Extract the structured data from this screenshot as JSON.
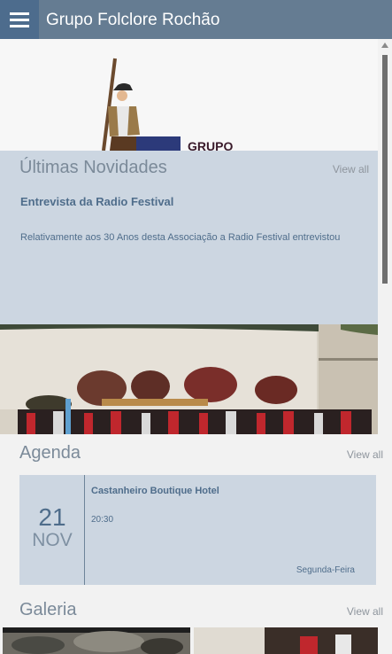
{
  "app": {
    "title": "Grupo Folclore Rochão"
  },
  "logo": {
    "text": "GRUPO"
  },
  "news": {
    "heading": "Últimas Novidades",
    "view_all": "View all",
    "item_title": "Entrevista da Radio Festival",
    "item_excerpt": "Relativamente aos 30 Anos desta Associação a Radio Festival entrevistou"
  },
  "agenda": {
    "heading": "Agenda",
    "view_all": "View all",
    "event": {
      "day": "21",
      "month": "NOV",
      "title": "Castanheiro Boutique Hotel",
      "time": "20:30",
      "weekday": "Segunda-Feira"
    }
  },
  "gallery": {
    "heading": "Galeria",
    "view_all": "View all"
  },
  "icons": {
    "menu": "hamburger-menu-icon",
    "scroll_up": "scroll-up-arrow-icon"
  },
  "colors": {
    "appbar": "#657c92",
    "menu_button": "#4d6c8d",
    "card_background": "#ccd6e1",
    "accent_text": "#4f6d8b"
  }
}
